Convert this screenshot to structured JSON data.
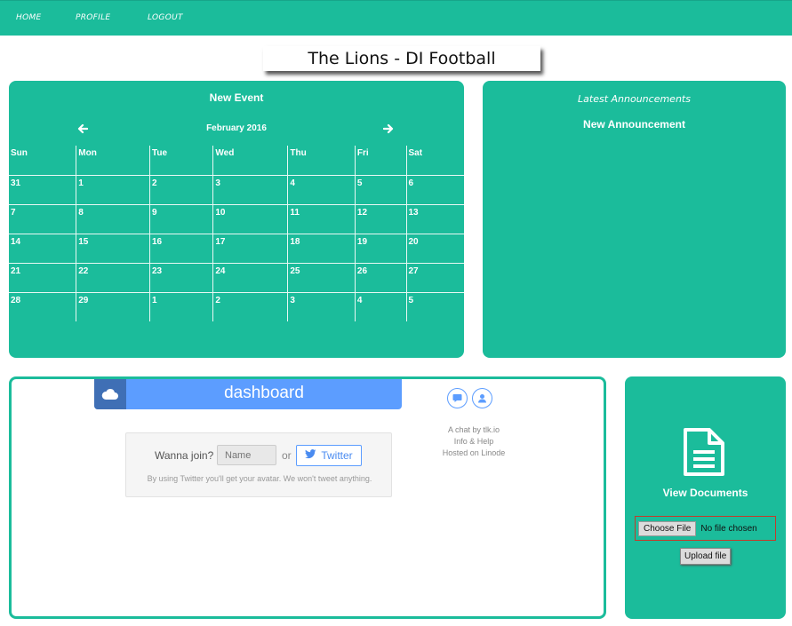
{
  "nav": {
    "items": [
      "HOME",
      "PROFILE",
      "LOGOUT"
    ]
  },
  "page": {
    "title": "The Lions - DI Football"
  },
  "calendar": {
    "new_event_label": "New Event",
    "month_label": "February 2016",
    "prev_icon": "arrow-left-icon",
    "next_icon": "arrow-right-icon",
    "weekdays": [
      "Sun",
      "Mon",
      "Tue",
      "Wed",
      "Thu",
      "Fri",
      "Sat"
    ],
    "weeks": [
      [
        "31",
        "1",
        "2",
        "3",
        "4",
        "5",
        "6"
      ],
      [
        "7",
        "8",
        "9",
        "10",
        "11",
        "12",
        "13"
      ],
      [
        "14",
        "15",
        "16",
        "17",
        "18",
        "19",
        "20"
      ],
      [
        "21",
        "22",
        "23",
        "24",
        "25",
        "26",
        "27"
      ],
      [
        "28",
        "29",
        "1",
        "2",
        "3",
        "4",
        "5"
      ]
    ]
  },
  "announcements": {
    "heading": "Latest Announcements",
    "new_label": "New Announcement"
  },
  "chat": {
    "dashboard_label": "dashboard",
    "cloud_icon": "cloud-icon",
    "chat_icon": "speech-bubble-icon",
    "user_icon": "user-icon",
    "join_label": "Wanna join?",
    "name_placeholder": "Name",
    "or_label": "or",
    "twitter_label": "Twitter",
    "note": "By using Twitter you'll get your avatar. We won't tweet anything.",
    "info": [
      "A chat by tlk.io",
      "Info & Help",
      "Hosted on Linode"
    ]
  },
  "documents": {
    "icon": "document-icon",
    "label": "View Documents",
    "choose_file_label": "Choose File",
    "no_file_label": "No file chosen",
    "upload_label": "Upload file"
  },
  "colors": {
    "accent": "#1bbc9b",
    "chat_blue": "#5c9dff",
    "chat_dark_blue": "#3f6fb5"
  }
}
